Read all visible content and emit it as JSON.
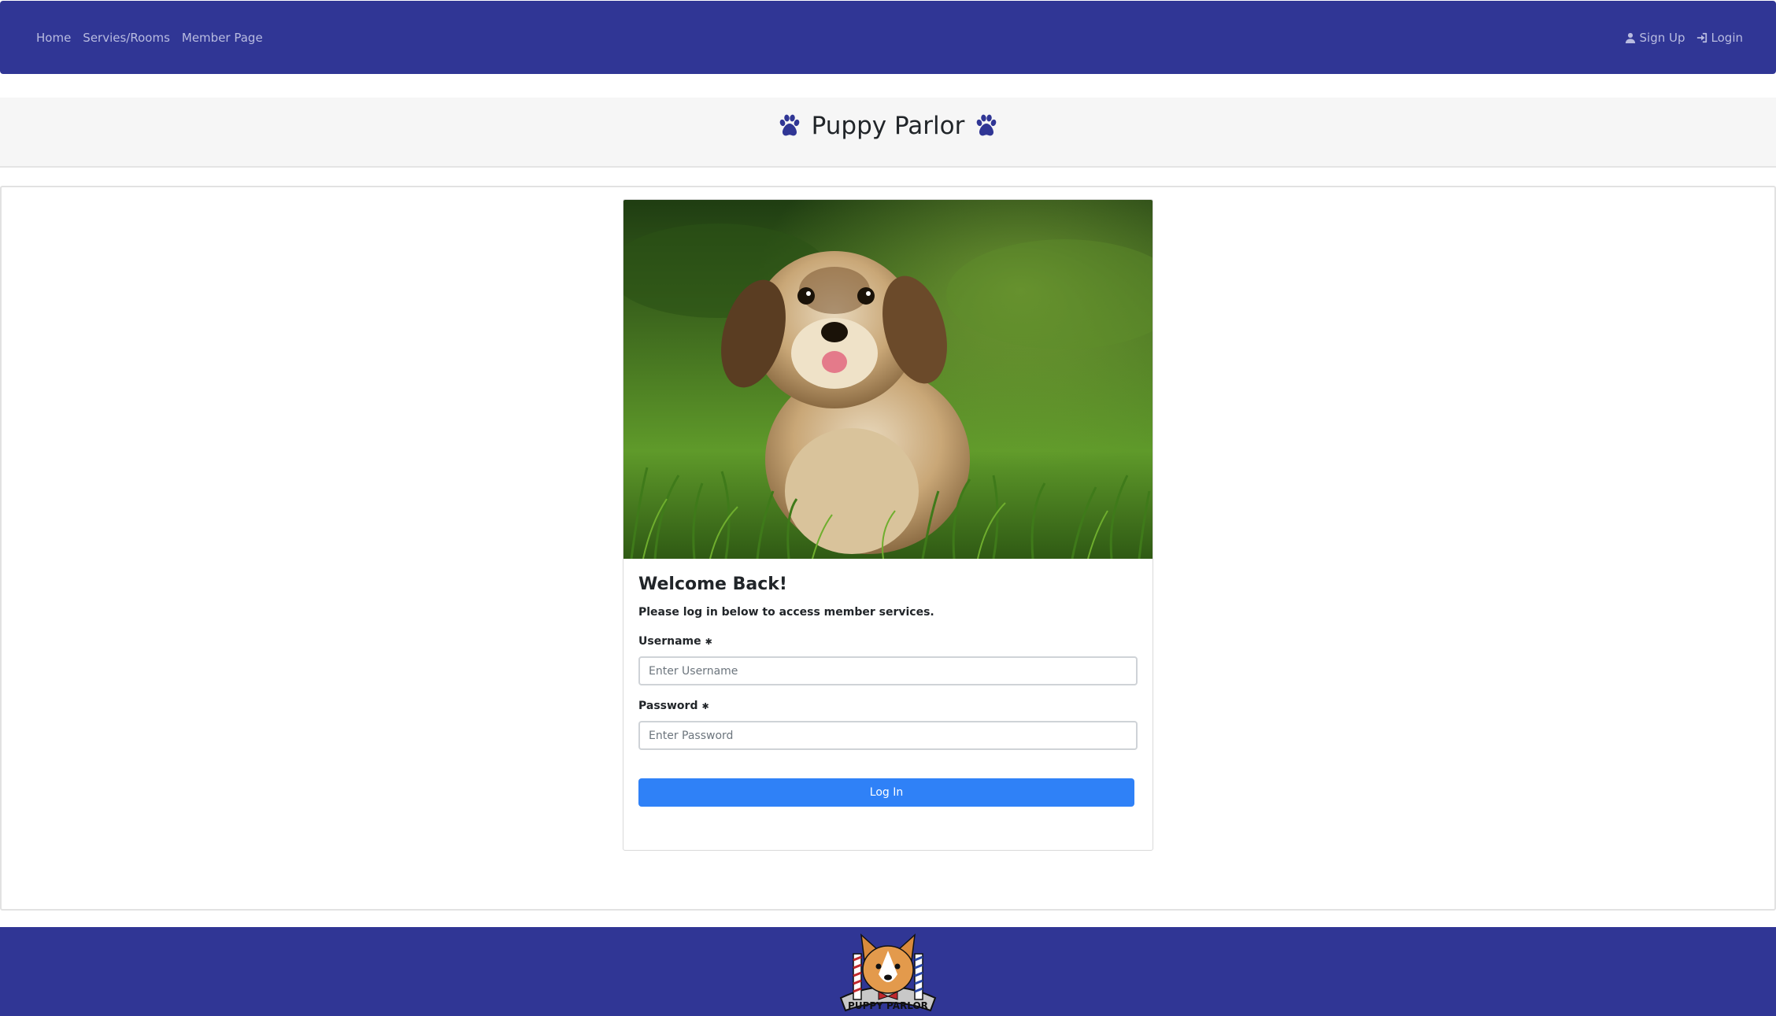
{
  "nav": {
    "links": [
      "Home",
      "Servies/Rooms",
      "Member Page"
    ],
    "signup_label": "Sign Up",
    "login_label": "Login"
  },
  "header": {
    "title": "Puppy Parlor"
  },
  "login_card": {
    "title": "Welcome Back!",
    "subtitle": "Please log in below to access member services.",
    "username_label": "Username",
    "username_placeholder": "Enter Username",
    "username_value": "",
    "password_label": "Password",
    "password_placeholder": "Enter Password",
    "password_value": "",
    "required_marker": "✱",
    "submit_label": "Log In"
  },
  "footer": {
    "logo_text": "PUPPY PARLOR"
  },
  "colors": {
    "brand": "#303695",
    "button": "#2f81f7"
  },
  "icons": [
    "user-icon",
    "sign-in-icon",
    "paw-icon"
  ]
}
